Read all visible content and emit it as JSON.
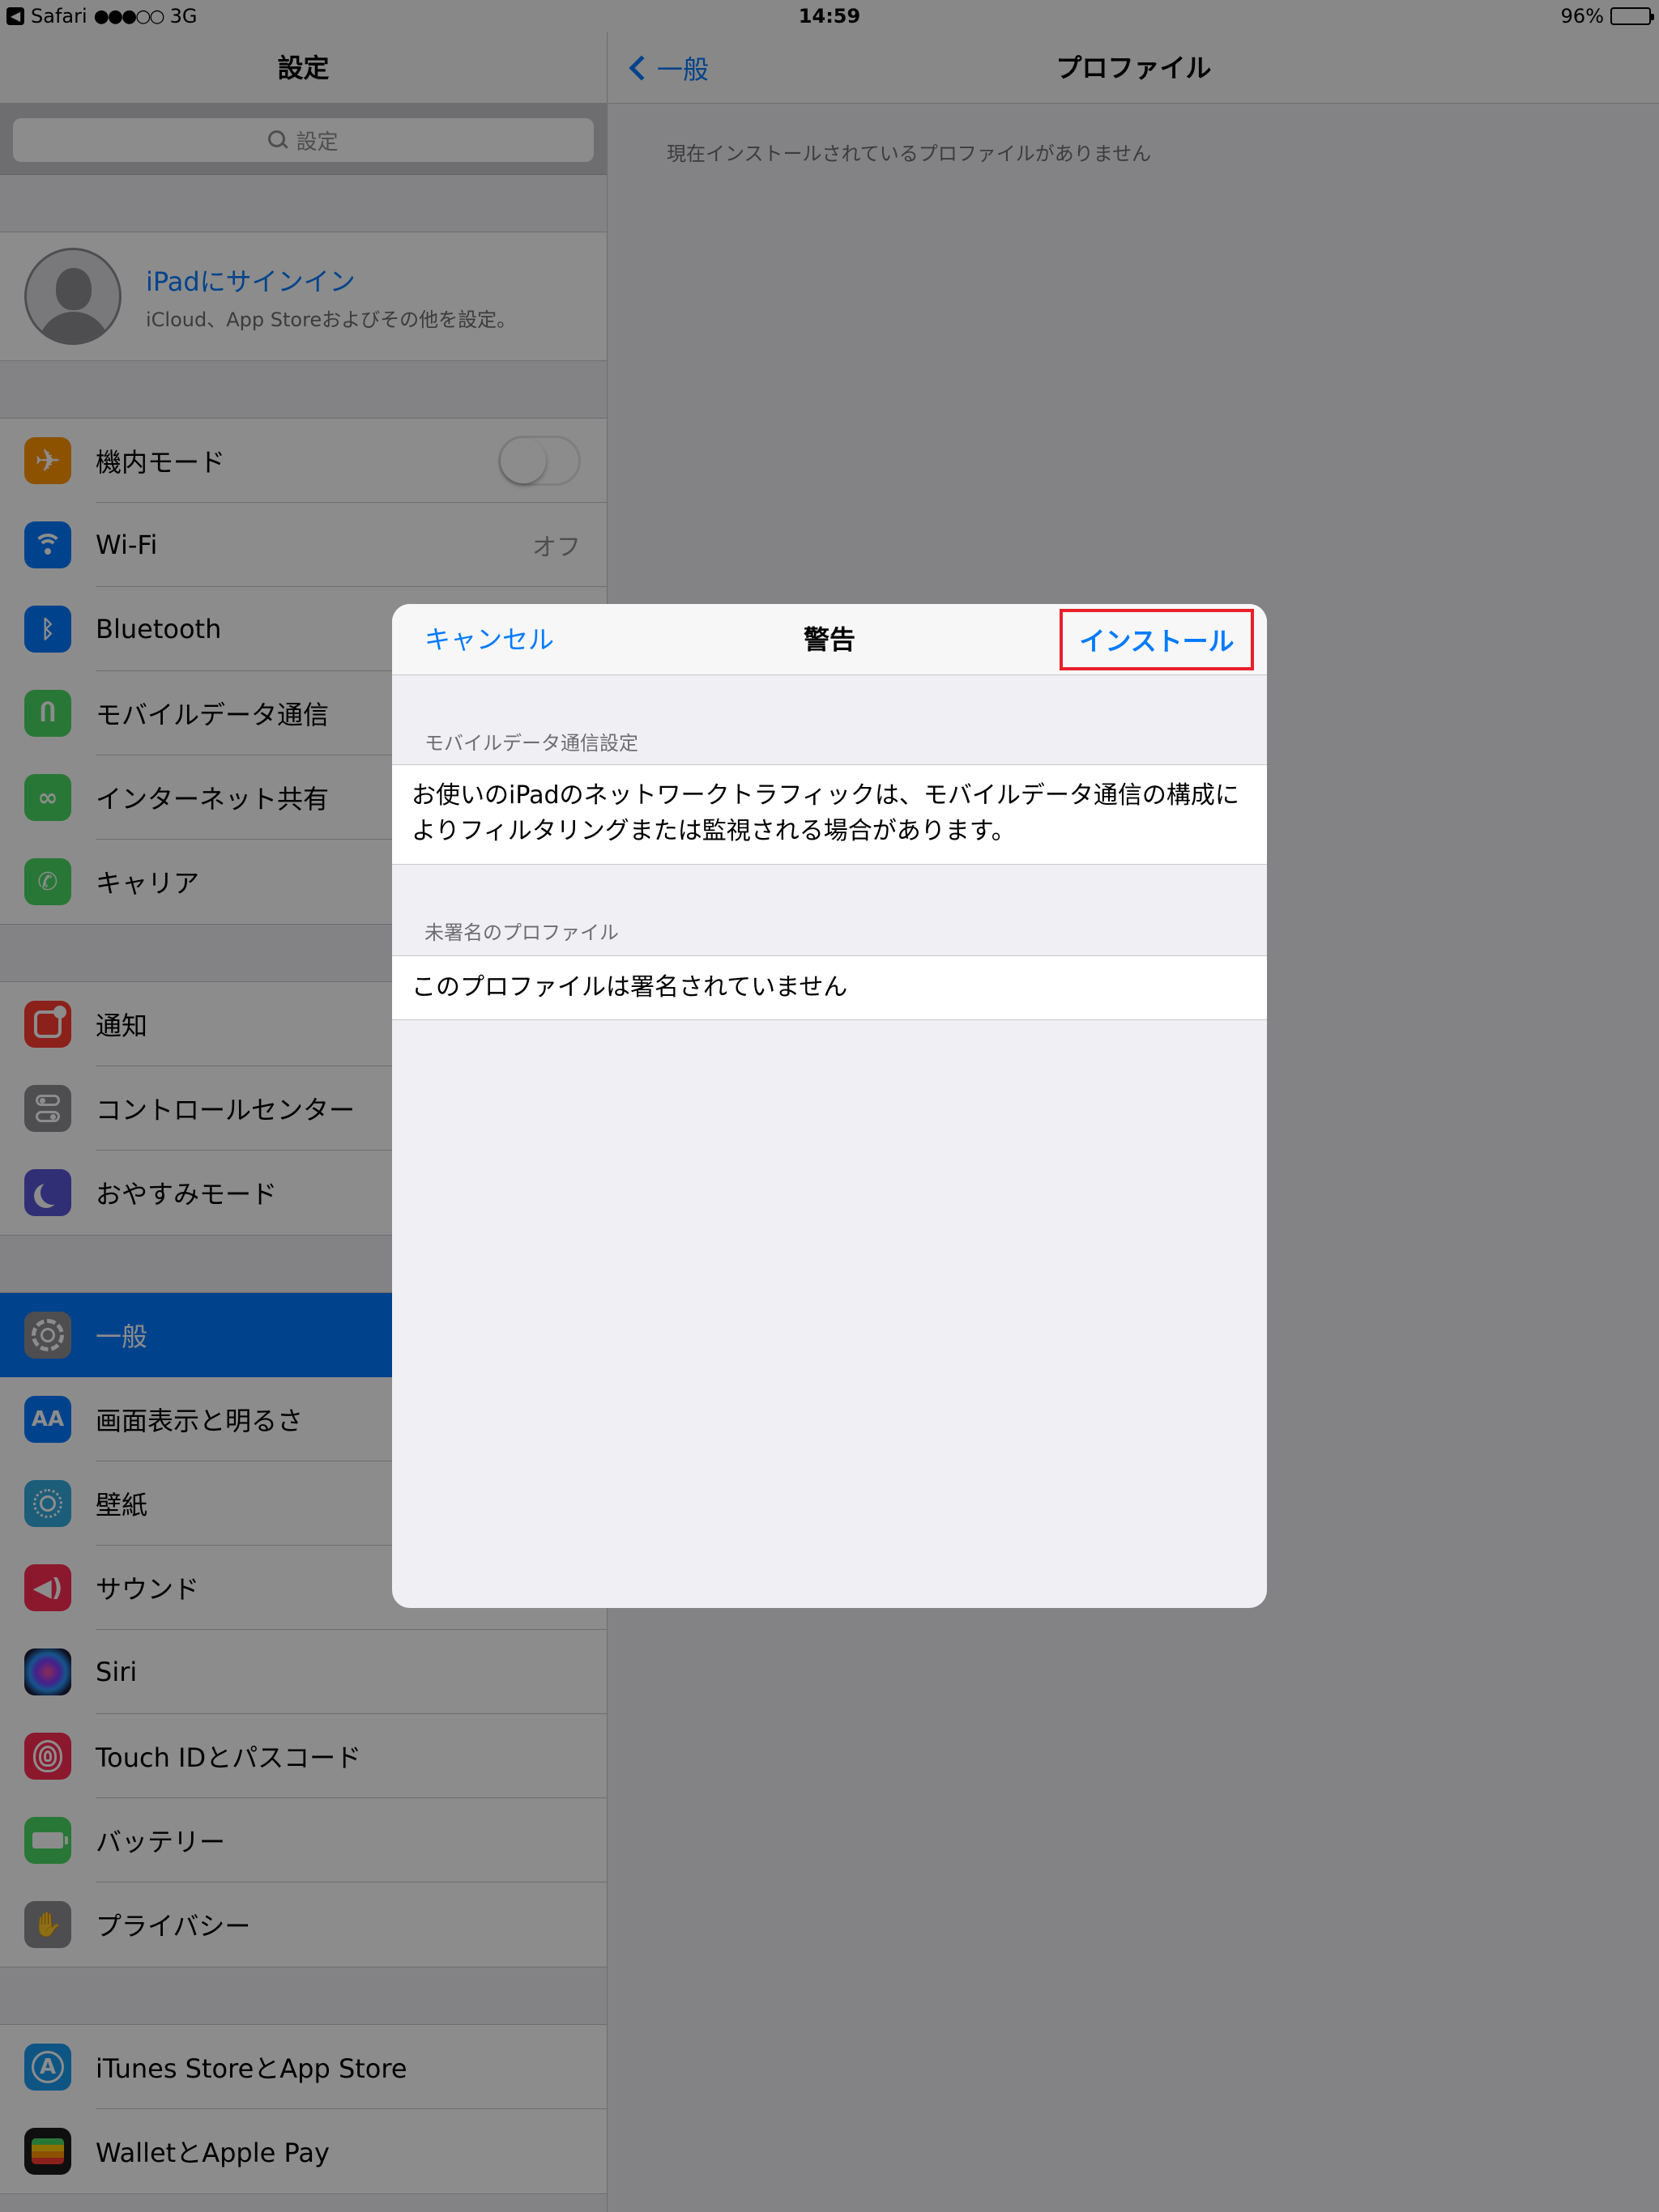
{
  "status_bar": {
    "back_app": "Safari",
    "signal": "●●●○○",
    "network": "3G",
    "time": "14:59",
    "battery": "96%",
    "battery_level": 0.96
  },
  "sidebar": {
    "title": "設定",
    "search_placeholder": "設定",
    "profile": {
      "title": "iPadにサインイン",
      "subtitle": "iCloud、App Storeおよびその他を設定。"
    },
    "groups": [
      [
        {
          "label": "機内モード",
          "icon": "airplane-icon",
          "color": "#ff9500",
          "toggle": false
        },
        {
          "label": "Wi-Fi",
          "icon": "wifi-icon",
          "color": "#007aff",
          "value": "オフ"
        },
        {
          "label": "Bluetooth",
          "icon": "bluetooth-icon",
          "color": "#007aff"
        },
        {
          "label": "モバイルデータ通信",
          "icon": "antenna-icon",
          "color": "#4cd964"
        },
        {
          "label": "インターネット共有",
          "icon": "link-icon",
          "color": "#4cd964"
        },
        {
          "label": "キャリア",
          "icon": "phone-icon",
          "color": "#4cd964"
        }
      ],
      [
        {
          "label": "通知",
          "icon": "notifications-icon",
          "color": "#ff3b30"
        },
        {
          "label": "コントロールセンター",
          "icon": "control-center-icon",
          "color": "#8e8e93"
        },
        {
          "label": "おやすみモード",
          "icon": "moon-icon",
          "color": "#5856d6"
        }
      ],
      [
        {
          "label": "一般",
          "icon": "gear-icon",
          "color": "#8e8e93",
          "selected": true
        },
        {
          "label": "画面表示と明るさ",
          "icon": "display-icon",
          "color": "#007aff"
        },
        {
          "label": "壁紙",
          "icon": "wallpaper-icon",
          "color": "#34aadc"
        },
        {
          "label": "サウンド",
          "icon": "speaker-icon",
          "color": "#ff2d55"
        },
        {
          "label": "Siri",
          "icon": "siri-icon",
          "color": "#1c1c3a"
        },
        {
          "label": "Touch IDとパスコード",
          "icon": "fingerprint-icon",
          "color": "#ff2d55"
        },
        {
          "label": "バッテリー",
          "icon": "battery-icon",
          "color": "#4cd964"
        },
        {
          "label": "プライバシー",
          "icon": "hand-icon",
          "color": "#8e8e93"
        }
      ],
      [
        {
          "label": "iTunes StoreとApp Store",
          "icon": "app-store-icon",
          "color": "#1a9bf0"
        },
        {
          "label": "WalletとApple Pay",
          "icon": "wallet-icon",
          "color": "#1c1c1e"
        }
      ]
    ]
  },
  "detail": {
    "back_label": "一般",
    "title": "プロファイル",
    "empty_note": "現在インストールされているプロファイルがありません"
  },
  "modal": {
    "cancel": "キャンセル",
    "title": "警告",
    "install": "インストール",
    "sections": [
      {
        "header": "モバイルデータ通信設定",
        "body": "お使いのiPadのネットワークトラフィックは、モバイルデータ通信の構成によりフィルタリングまたは監視される場合があります。"
      },
      {
        "header": "未署名のプロファイル",
        "body": "このプロファイルは署名されていません"
      }
    ]
  },
  "colors": {
    "accent": "#007aff",
    "highlight_border": "#e8202a"
  }
}
